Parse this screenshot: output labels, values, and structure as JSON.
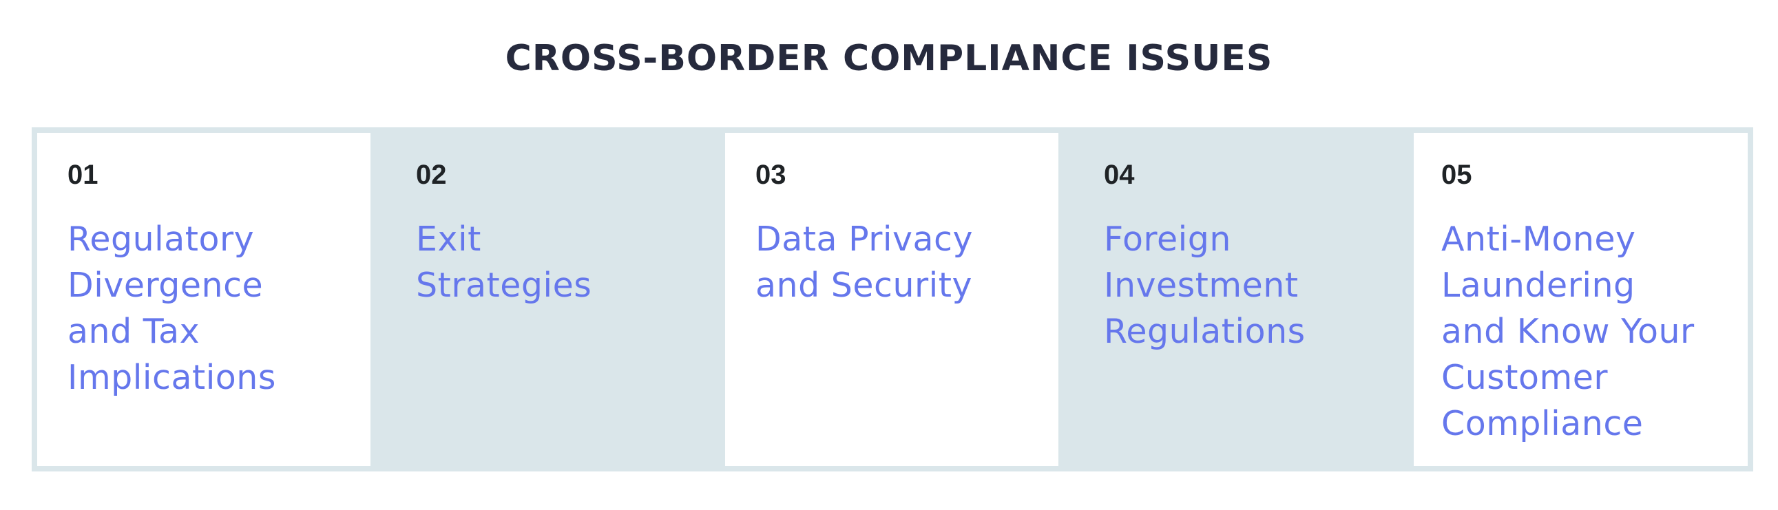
{
  "title": "CROSS-BORDER COMPLIANCE ISSUES",
  "colors": {
    "title": "#262a3d",
    "number": "#1f2326",
    "heading": "#6577ec",
    "shaded_panel": "#dae6ea",
    "white_panel": "#ffffff"
  },
  "issues": [
    {
      "number": "01",
      "heading": "Regulatory\nDivergence\nand Tax\nImplications",
      "style": "white"
    },
    {
      "number": "02",
      "heading": "Exit\nStrategies",
      "style": "shaded"
    },
    {
      "number": "03",
      "heading": "Data Privacy\nand Security",
      "style": "white"
    },
    {
      "number": "04",
      "heading": "Foreign\nInvestment\nRegulations",
      "style": "shaded"
    },
    {
      "number": "05",
      "heading": "Anti-Money\nLaundering\nand Know Your\nCustomer\nCompliance",
      "style": "white"
    }
  ]
}
